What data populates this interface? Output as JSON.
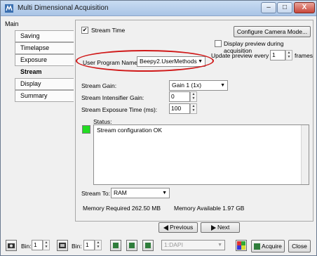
{
  "window": {
    "title": "Multi Dimensional Acquisition",
    "minimize_glyph": "–",
    "maximize_glyph": "□",
    "close_glyph": "X"
  },
  "nav": {
    "main_label": "Main",
    "items": [
      {
        "label": "Saving"
      },
      {
        "label": "Timelapse"
      },
      {
        "label": "Exposure"
      },
      {
        "label": "Stream",
        "active": true
      },
      {
        "label": "Display"
      },
      {
        "label": "Summary"
      }
    ]
  },
  "stream": {
    "stream_time_label": "Stream Time",
    "stream_time_checked": true,
    "configure_camera_label": "Configure Camera Mode...",
    "display_preview_label": "Display preview during acquisition",
    "display_preview_checked": false,
    "update_preview_label": "Update preview every",
    "update_preview_value": "1",
    "frames_label": "frames",
    "user_program_label": "User Program Name:",
    "user_program_value": "Beepy2.UserMethods",
    "stream_gain_label": "Stream Gain:",
    "stream_gain_value": "Gain 1 (1x)",
    "intensifier_gain_label": "Stream Intensifier Gain:",
    "intensifier_gain_value": "0",
    "exposure_time_label": "Stream Exposure Time (ms):",
    "exposure_time_value": "100",
    "status_label": "Status:",
    "status_text": "Stream configuration OK",
    "status_color": "#22dd22",
    "stream_to_label": "Stream To:",
    "stream_to_value": "RAM",
    "memory_required": "Memory Required 262.50 MB",
    "memory_available": "Memory Available 1.97 GB",
    "previous_label": "Previous",
    "next_label": "Next"
  },
  "bottom": {
    "bin1_label": "Bin:",
    "bin1_value": "1",
    "bin2_label": "Bin:",
    "bin2_value": "1",
    "channel_value": "1:DAPI",
    "acquire_label": "Acquire",
    "close_label": "Close"
  },
  "colors": {
    "highlight": "#d01818",
    "accent_green": "#2f7d3b"
  }
}
